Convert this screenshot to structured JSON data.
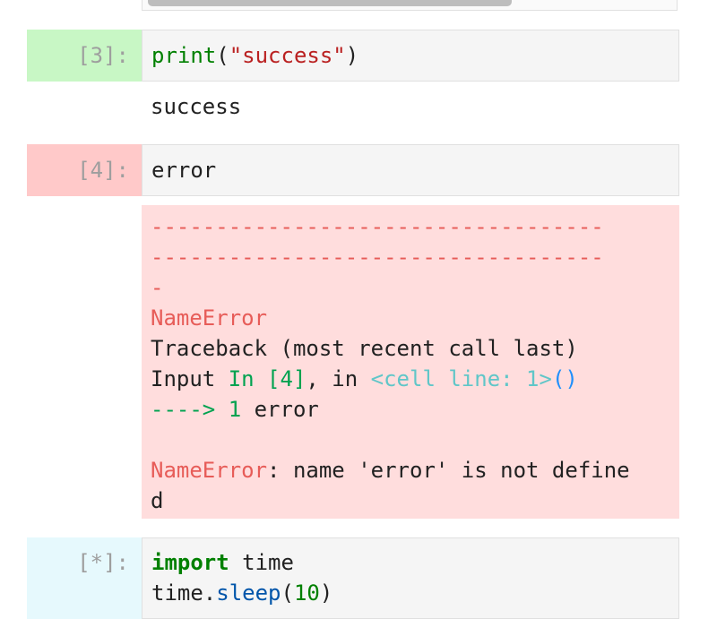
{
  "cells": [
    {
      "prompt": "[3]:",
      "status": "success",
      "input": {
        "fn": "print",
        "open": "(",
        "arg": "\"success\"",
        "close": ")"
      },
      "output": "success"
    },
    {
      "prompt": "[4]:",
      "status": "error",
      "input": {
        "text": "error"
      },
      "traceback": {
        "dash_line_1": "-----------------------------------",
        "dash_line_2": "-----------------------------------",
        "dash_line_3": "-",
        "error_name": "NameError",
        "traceback_header": "Traceback (most recent call last)",
        "input_prefix": "Input ",
        "input_ref": "In [4]",
        "input_sep": ", in ",
        "cell_ref": "<cell line: 1>",
        "cell_paren": "()",
        "arrow": "---->",
        "line_no": "1",
        "line_code": "error",
        "final_error_name": "NameError",
        "final_message_1": ": name 'error' is not define",
        "final_message_2": "d"
      }
    },
    {
      "prompt": "[*]:",
      "status": "running",
      "input": {
        "kw": "import",
        "mod": " time",
        "line2_obj": "time.",
        "line2_fn": "sleep",
        "line2_open": "(",
        "line2_num": "10",
        "line2_close": ")"
      }
    }
  ],
  "colors": {
    "success_prompt_bg": "#c8f7c5",
    "error_prompt_bg": "#ffc9c9",
    "running_prompt_bg": "#e6f9fd",
    "error_output_bg": "#ffdddd"
  }
}
